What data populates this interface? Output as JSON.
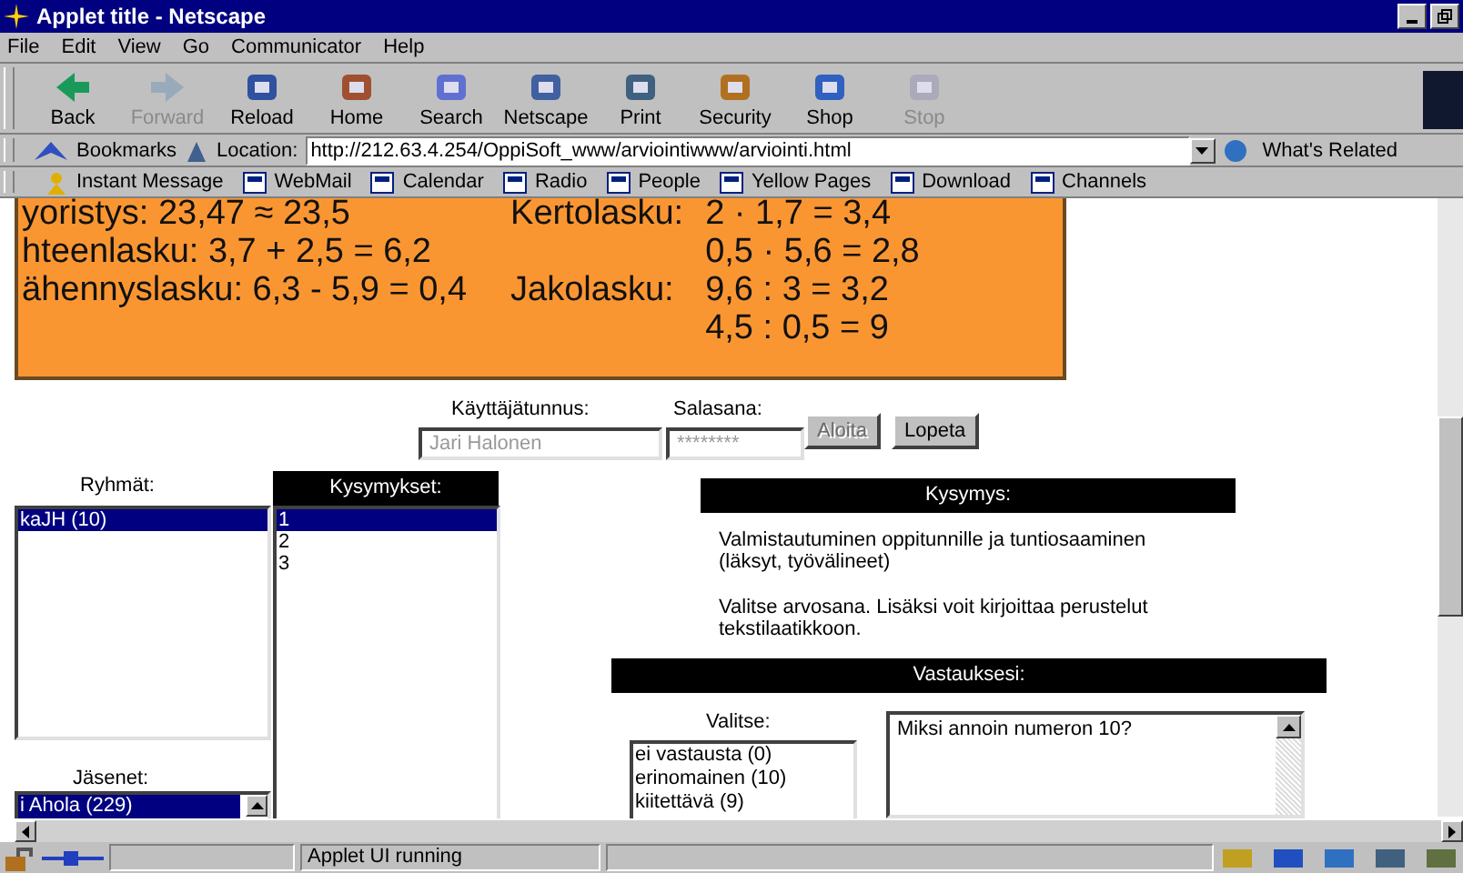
{
  "window": {
    "title": "Applet title - Netscape"
  },
  "menu": [
    "File",
    "Edit",
    "View",
    "Go",
    "Communicator",
    "Help"
  ],
  "toolbar": [
    {
      "label": "Back",
      "disabled": false
    },
    {
      "label": "Forward",
      "disabled": true
    },
    {
      "label": "Reload",
      "disabled": false
    },
    {
      "label": "Home",
      "disabled": false
    },
    {
      "label": "Search",
      "disabled": false
    },
    {
      "label": "Netscape",
      "disabled": false
    },
    {
      "label": "Print",
      "disabled": false
    },
    {
      "label": "Security",
      "disabled": false
    },
    {
      "label": "Shop",
      "disabled": false
    },
    {
      "label": "Stop",
      "disabled": true
    }
  ],
  "location_bar": {
    "bookmarks": "Bookmarks",
    "label": "Location:",
    "url": "http://212.63.4.254/OppiSoft_www/arviointiwww/arviointi.html",
    "related": "What's Related"
  },
  "personal_bar": [
    "Instant Message",
    "WebMail",
    "Calendar",
    "Radio",
    "People",
    "Yellow Pages",
    "Download",
    "Channels"
  ],
  "banner": {
    "left_lines": [
      "yoristys: 23,47 ≈ 23,5",
      "hteenlasku: 3,7 + 2,5 = 6,2",
      "ähennyslasku: 6,3 - 5,9 = 0,4"
    ],
    "right_rows": [
      {
        "label": "Kertolasku:",
        "expr": "2 · 1,7 = 3,4"
      },
      {
        "label": "",
        "expr": "0,5 · 5,6 = 2,8"
      },
      {
        "label": "Jakolasku:",
        "expr": "9,6 : 3 = 3,2"
      },
      {
        "label": "",
        "expr": "4,5 : 0,5 = 9"
      }
    ]
  },
  "login": {
    "username_label": "Käyttäjätunnus:",
    "username": "Jari Halonen",
    "password_label": "Salasana:",
    "password": "********",
    "buttons": [
      {
        "label": "Aloita",
        "disabled": true
      },
      {
        "label": "Lopeta",
        "disabled": false
      }
    ]
  },
  "groups": {
    "label": "Ryhmät:",
    "items": [
      {
        "label": "kaJH (10)",
        "selected": true
      }
    ]
  },
  "members": {
    "label": "Jäsenet:",
    "items": [
      {
        "label": "i Ahola (229)",
        "selected": true
      }
    ]
  },
  "questions": {
    "header": "Kysymykset:",
    "items": [
      {
        "label": "1",
        "selected": true
      },
      {
        "label": "2",
        "selected": false
      },
      {
        "label": "3",
        "selected": false
      }
    ]
  },
  "question": {
    "header": "Kysymys:",
    "paragraphs": [
      "Valmistautuminen oppitunnille ja tuntiosaaminen (läksyt, työvälineet)",
      "Valitse arvosana. Lisäksi voit kirjoittaa perustelut tekstilaatikkoon."
    ]
  },
  "answer": {
    "header": "Vastauksesi:",
    "choose_label": "Valitse:",
    "options": [
      {
        "label": "ei vastausta (0)",
        "selected": false
      },
      {
        "label": "erinomainen (10)",
        "selected": false
      },
      {
        "label": "kiitettävä (9)",
        "selected": false
      }
    ],
    "text": "Miksi annoin numeron 10?"
  },
  "status_bar": {
    "text": "Applet UI running"
  }
}
